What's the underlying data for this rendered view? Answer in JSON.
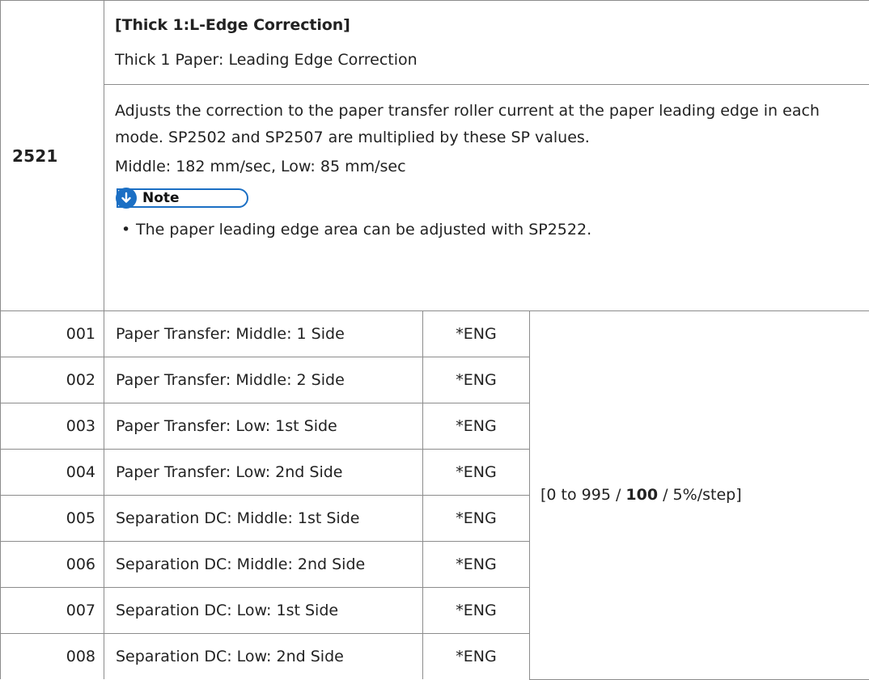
{
  "sp_number": "2521",
  "title": "[Thick 1:L-Edge Correction]",
  "subtitle": "Thick 1 Paper: Leading Edge Correction",
  "description": "Adjusts the correction to the paper transfer roller current at the paper leading edge in each mode. SP2502 and SP2507 are multiplied by these SP values.",
  "speeds": "Middle: 182 mm/sec, Low: 85 mm/sec",
  "note": {
    "icon": "down-arrow-icon",
    "label": "Note",
    "items": [
      "The paper leading edge area can be adjusted with SP2522."
    ],
    "accent_color": "#1b6fc4"
  },
  "rows": [
    {
      "num": "001",
      "name": "Paper Transfer: Middle: 1 Side",
      "type": "*ENG"
    },
    {
      "num": "002",
      "name": "Paper Transfer: Middle: 2 Side",
      "type": "*ENG"
    },
    {
      "num": "003",
      "name": "Paper Transfer: Low: 1st Side",
      "type": "*ENG"
    },
    {
      "num": "004",
      "name": "Paper Transfer: Low: 2nd Side",
      "type": "*ENG"
    },
    {
      "num": "005",
      "name": "Separation DC: Middle: 1st Side",
      "type": "*ENG"
    },
    {
      "num": "006",
      "name": "Separation DC: Middle: 2nd Side",
      "type": "*ENG"
    },
    {
      "num": "007",
      "name": "Separation DC: Low: 1st Side",
      "type": "*ENG"
    },
    {
      "num": "008",
      "name": "Separation DC: Low: 2nd Side",
      "type": "*ENG"
    }
  ],
  "range": {
    "prefix": "[0 to 995 / ",
    "default": "100",
    "suffix": " / 5%/step]"
  }
}
